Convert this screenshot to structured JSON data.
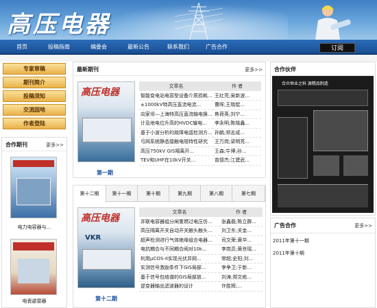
{
  "header": {
    "logo_text": "高压电器"
  },
  "nav": {
    "items": [
      "首页",
      "投稿指南",
      "编委会",
      "最新公告",
      "联系我们",
      "广告合作"
    ],
    "subscribe": "订阅"
  },
  "left": {
    "buttons": [
      "专家审稿",
      "期刊简介",
      "投稿须知",
      "交流园地",
      "作者登陆"
    ],
    "partner_journals": {
      "title": "合作期刊",
      "more": "更多>>",
      "items": [
        {
          "caption": "电力电容器与..."
        },
        {
          "caption": "电瓷避雷器"
        }
      ]
    }
  },
  "latest": {
    "title": "最新期刊",
    "more": "更多>>",
    "issue": "第一期",
    "headers": [
      "文章名",
      "作 者"
    ],
    "rows": [
      [
        "智能变电站电容型设备介质损耗...",
        "王红亮;吴新波..."
      ],
      [
        "±1000kV特高压直流电流...",
        "曹晖;王晓锟..."
      ],
      [
        "向家坝—上海特高压直流输电换...",
        "焦荷英;刘宁..."
      ],
      [
        "计及地电位升高的HVDC输电...",
        "李永明;陈晓鑫..."
      ],
      [
        "基于小波分析的故障电弧检测方...",
        "孙鹏;郑志成..."
      ],
      [
        "弓网系统静态接触电阻特性研究",
        "王万岗;梁明亮..."
      ],
      [
        "高压750kV GIS隔离开...",
        "王森;牛博;孙..."
      ],
      [
        "TEV和UHF在10kV开关...",
        "曾德杰;江建武..."
      ]
    ]
  },
  "archive": {
    "tabs": [
      "第十二期",
      "第十一期",
      "第十期",
      "第九期",
      "第八期",
      "第七期"
    ],
    "issue": "第十二期",
    "headers": [
      "文章名",
      "作 者"
    ],
    "rows": [
      [
        "并联电容器组分闸重燃过电压仿...",
        "张鑫磊;陈立群..."
      ],
      [
        "高压隔离开关自动开关触头触头...",
        "刘卫东;关金..."
      ],
      [
        "超声检测进行气体绝缘组合电器...",
        "司文荣;黄华..."
      ],
      [
        "电抗耦合与不同耦合阀对10k...",
        "李岗员;黄世瑶..."
      ],
      [
        "利用μCOS-II实现光伏并网...",
        "常超;史阳;刘..."
      ],
      [
        "实测信号激励条件下GIS局部...",
        "李争卫;于新..."
      ],
      [
        "基于信号包络谱的GIS局部放...",
        "刘涛;郑文栋..."
      ],
      [
        "逆变器输出滤波器的设计",
        "许胜辉;..."
      ]
    ]
  },
  "partners": {
    "title": "合作伙伴",
    "ad_brand": "合众恒业之科 源精品制造"
  },
  "ads": {
    "title": "广告合作",
    "more": "更多>>",
    "items": [
      "2011年第十一期",
      "2011年第十期"
    ]
  }
}
